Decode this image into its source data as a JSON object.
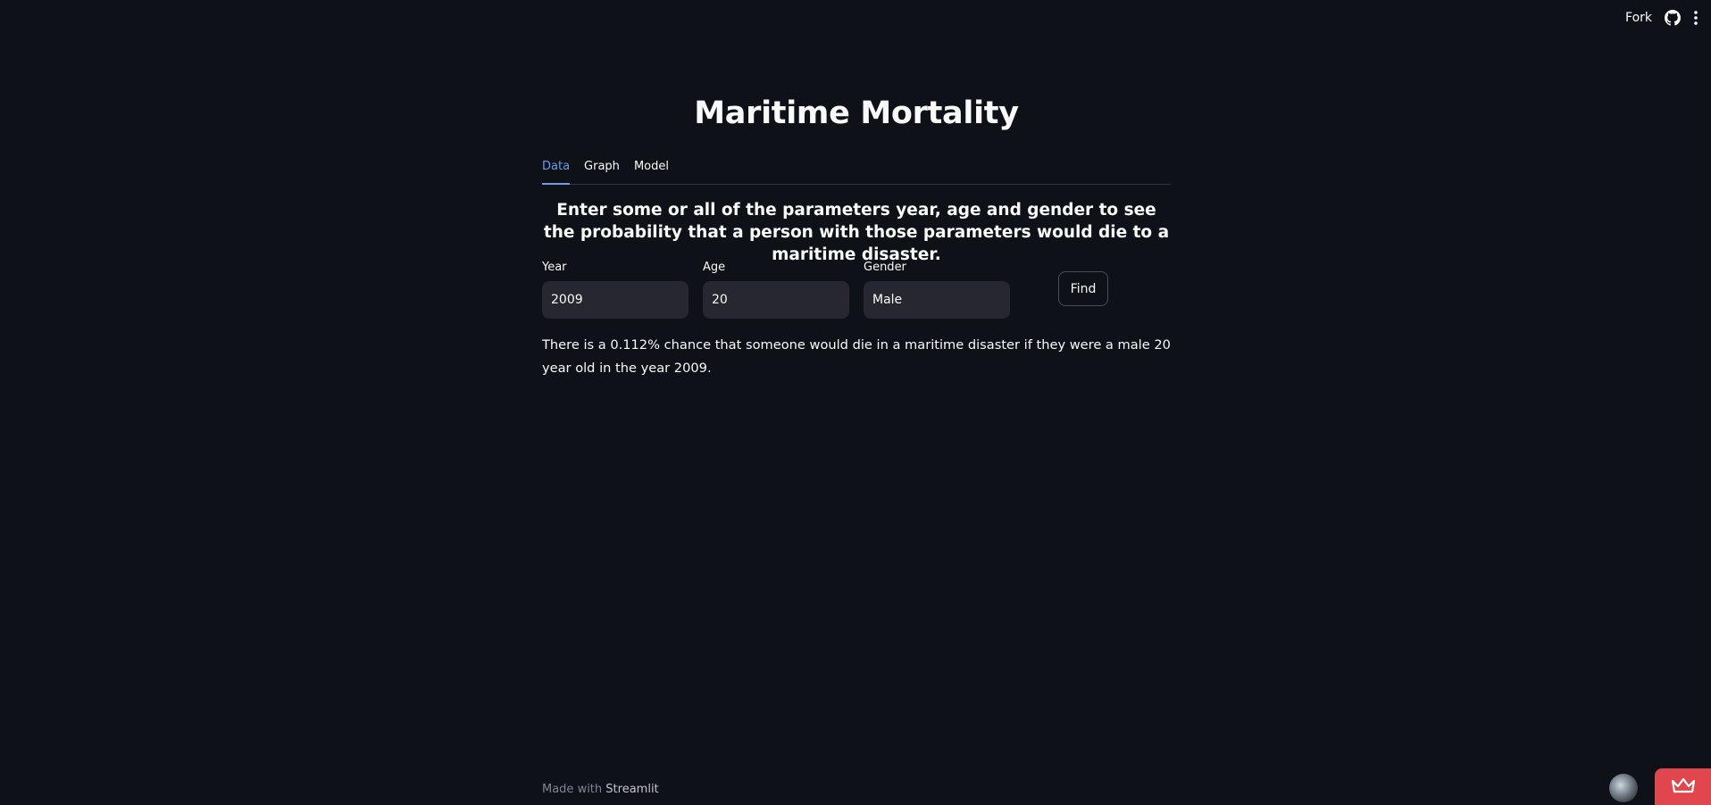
{
  "topbar": {
    "fork_label": "Fork",
    "github_icon": "github-icon",
    "menu_icon": "kebab-menu-icon"
  },
  "main": {
    "title": "Maritime Mortality",
    "tabs": [
      {
        "label": "Data",
        "active": true
      },
      {
        "label": "Graph",
        "active": false
      },
      {
        "label": "Model",
        "active": false
      }
    ],
    "subheading": "Enter some or all of the parameters year, age and gender to see the probability that a person with those parameters would die to a maritime disaster.",
    "fields": {
      "year": {
        "label": "Year",
        "value": "2009"
      },
      "age": {
        "label": "Age",
        "value": "20"
      },
      "gender": {
        "label": "Gender",
        "value": "Male"
      }
    },
    "find_label": "Find",
    "result": "There is a 0.112% chance that someone would die in a maritime disaster if they were a male 20 year old in the year 2009."
  },
  "footer": {
    "made_with": "Made with",
    "brand": "Streamlit"
  },
  "colors": {
    "background": "#0e1117",
    "text": "#fafafa",
    "accent": "#6d9ee6",
    "input_bg": "#262730",
    "badge": "#e0464b"
  }
}
